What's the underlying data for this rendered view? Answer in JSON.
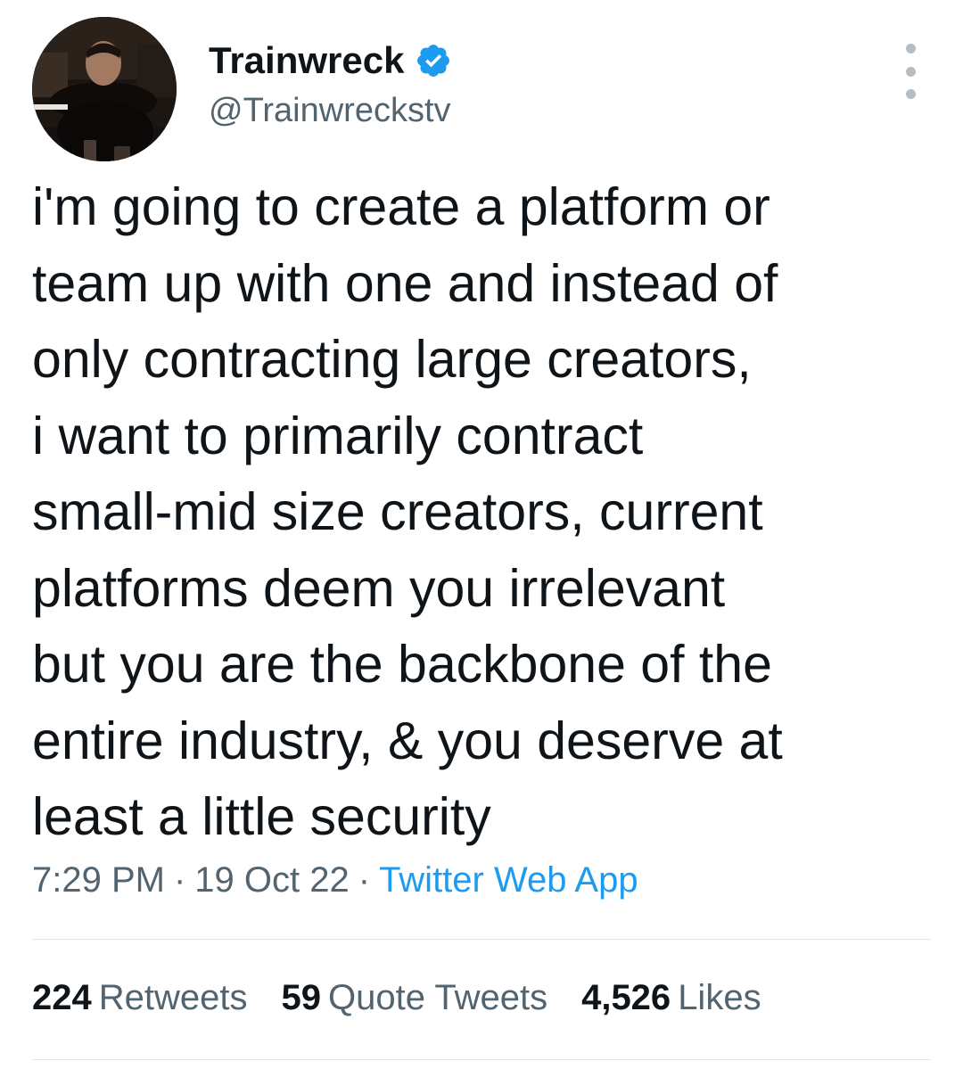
{
  "author": {
    "display_name": "Trainwreck",
    "handle": "@Trainwreckstv",
    "verified": true,
    "avatar_icon": "profile-photo"
  },
  "tweet": {
    "lines": [
      "i'm going to create a platform or",
      "team up with one and instead of",
      "only contracting large creators,",
      "i want to primarily contract",
      "small-mid size creators, current",
      "platforms deem you irrelevant",
      "but you are the backbone of the",
      "entire industry, & you deserve at",
      "least a little security"
    ]
  },
  "meta": {
    "time": "7:29 PM",
    "separator": "·",
    "date": "19 Oct 22",
    "source": "Twitter Web App"
  },
  "stats": {
    "retweets_count": "224",
    "retweets_label": "Retweets",
    "quotes_count": "59",
    "quotes_label": "Quote Tweets",
    "likes_count": "4,526",
    "likes_label": "Likes"
  },
  "colors": {
    "text": "#0f1419",
    "secondary": "#536471",
    "link": "#1d9bf0",
    "divider": "#dfe4e8"
  }
}
